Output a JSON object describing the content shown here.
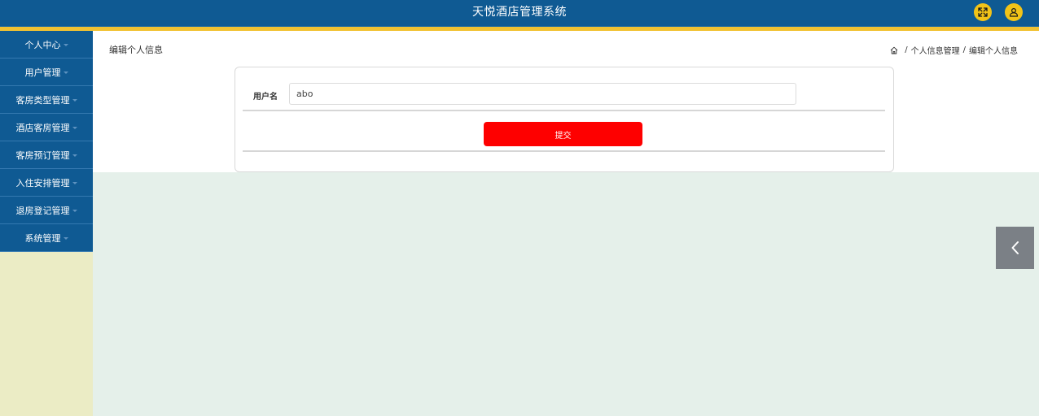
{
  "header": {
    "title": "天悦酒店管理系统",
    "icons": [
      "fullscreen-icon",
      "user-icon"
    ],
    "bar_color": "#0f5a93",
    "accent_color": "#f1c232",
    "icon_color": "#f2c318"
  },
  "sidebar": {
    "items": [
      {
        "label": "个人中心"
      },
      {
        "label": "用户管理"
      },
      {
        "label": "客房类型管理"
      },
      {
        "label": "酒店客房管理"
      },
      {
        "label": "客房预订管理"
      },
      {
        "label": "入住安排管理"
      },
      {
        "label": "退房登记管理"
      },
      {
        "label": "系统管理"
      }
    ]
  },
  "main": {
    "page_title": "编辑个人信息",
    "breadcrumb": {
      "parent": "个人信息管理",
      "separator": "/",
      "current": "编辑个人信息"
    },
    "form": {
      "username_label": "用户名",
      "username_value": "abo",
      "submit_label": "提交",
      "submit_color": "#fe0000"
    }
  },
  "collapse_tab": {
    "icon": "chevron-left-icon"
  }
}
